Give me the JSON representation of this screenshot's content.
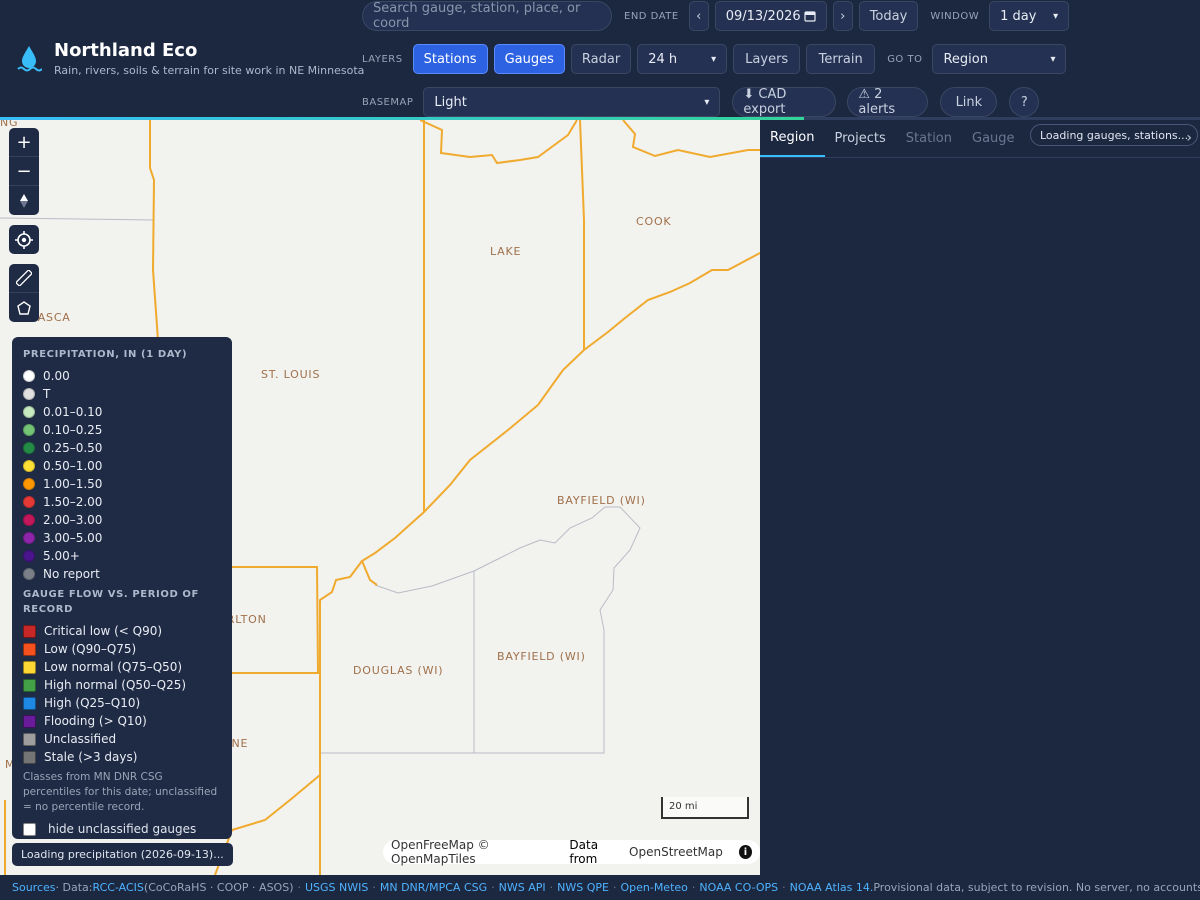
{
  "brand": {
    "title": "Northland Eco",
    "subtitle": "Rain, rivers, soils & terrain for site work in NE Minnesota"
  },
  "header": {
    "search_placeholder": "Search gauge, station, place, or coord",
    "end_date_label": "END DATE",
    "prev_label": "‹",
    "end_date": "09/13/2026",
    "next_label": "›",
    "today_label": "Today",
    "window_label": "WINDOW",
    "window_value": "1 day",
    "layers_label": "LAYERS",
    "layer_buttons": {
      "stations": "Stations",
      "gauges": "Gauges",
      "radar": "Radar"
    },
    "radar_range": "24 h",
    "layers_btn": "Layers",
    "terrain_btn": "Terrain",
    "goto_label": "GO TO",
    "goto_value": "Region",
    "basemap_label": "BASEMAP",
    "basemap_value": "Light",
    "cad_export": "⬇ CAD export",
    "alerts": "⚠ 2 alerts",
    "link": "Link",
    "help": "?",
    "load_progress": 0.67
  },
  "map": {
    "counties": {
      "cook": "COOK",
      "lake": "LAKE",
      "st_louis": "ST. LOUIS",
      "itasca": "ITASCA",
      "bayfield_ne": "BAYFIELD (WI)",
      "bayfield": "BAYFIELD (WI)",
      "douglas": "DOUGLAS (WI)",
      "carlton": "CARLTON",
      "pine": "PINE",
      "ng": "NG",
      "m": "M"
    },
    "scale_label": "20 mi",
    "attribution": {
      "a": "OpenFreeMap © OpenMapTiles",
      "b": "Data from",
      "c": "OpenStreetMap"
    },
    "loading_toast": "Loading precipitation (2026-09-13)..."
  },
  "legend": {
    "precip_title": "PRECIPITATION, IN (1 DAY)",
    "precip": [
      {
        "label": "0.00",
        "color": "#ffffff"
      },
      {
        "label": "T",
        "color": "#e0e0e0"
      },
      {
        "label": "0.01–0.10",
        "color": "#c7e9c0"
      },
      {
        "label": "0.10–0.25",
        "color": "#74c476"
      },
      {
        "label": "0.25–0.50",
        "color": "#238b45"
      },
      {
        "label": "0.50–1.00",
        "color": "#ffe135"
      },
      {
        "label": "1.00–1.50",
        "color": "#ff9800"
      },
      {
        "label": "1.50–2.00",
        "color": "#e53935"
      },
      {
        "label": "2.00–3.00",
        "color": "#c2185b"
      },
      {
        "label": "3.00–5.00",
        "color": "#8e24aa"
      },
      {
        "label": "5.00+",
        "color": "#4a148c"
      },
      {
        "label": "No report",
        "color": "#7a7f88"
      }
    ],
    "flow_title": "GAUGE FLOW VS. PERIOD OF RECORD",
    "flow": [
      {
        "label": "Critical low (< Q90)",
        "color": "#c62828"
      },
      {
        "label": "Low (Q90–Q75)",
        "color": "#f4511e"
      },
      {
        "label": "Low normal (Q75–Q50)",
        "color": "#fdd835"
      },
      {
        "label": "High normal (Q50–Q25)",
        "color": "#43a047"
      },
      {
        "label": "High (Q25–Q10)",
        "color": "#1e88e5"
      },
      {
        "label": "Flooding (> Q10)",
        "color": "#6a1b9a"
      },
      {
        "label": "Unclassified",
        "color": "#9e9e9e"
      },
      {
        "label": "Stale (>3 days)",
        "color": "#757575"
      }
    ],
    "note": "Classes from MN DNR CSG percentiles for this date; unclassified = no percentile record.",
    "hide_label": "hide unclassified gauges"
  },
  "panel": {
    "tabs": [
      "Region",
      "Projects",
      "Station",
      "Gauge"
    ],
    "status": "Loading gauges, stations...",
    "more": "›"
  },
  "footer": {
    "sources": "Sources",
    "data_label": " · Data: ",
    "rcc": "RCC-ACIS",
    "rcc_note": " (CoCoRaHS · COOP · ASOS)",
    "links": [
      "USGS NWIS",
      "MN DNR/MPCA CSG",
      "NWS API",
      "NWS QPE",
      "Open-Meteo",
      "NOAA CO-OPS",
      "NOAA Atlas 14."
    ],
    "tail": " Provisional data, subject to revision. No server, no accounts: everythin..."
  }
}
